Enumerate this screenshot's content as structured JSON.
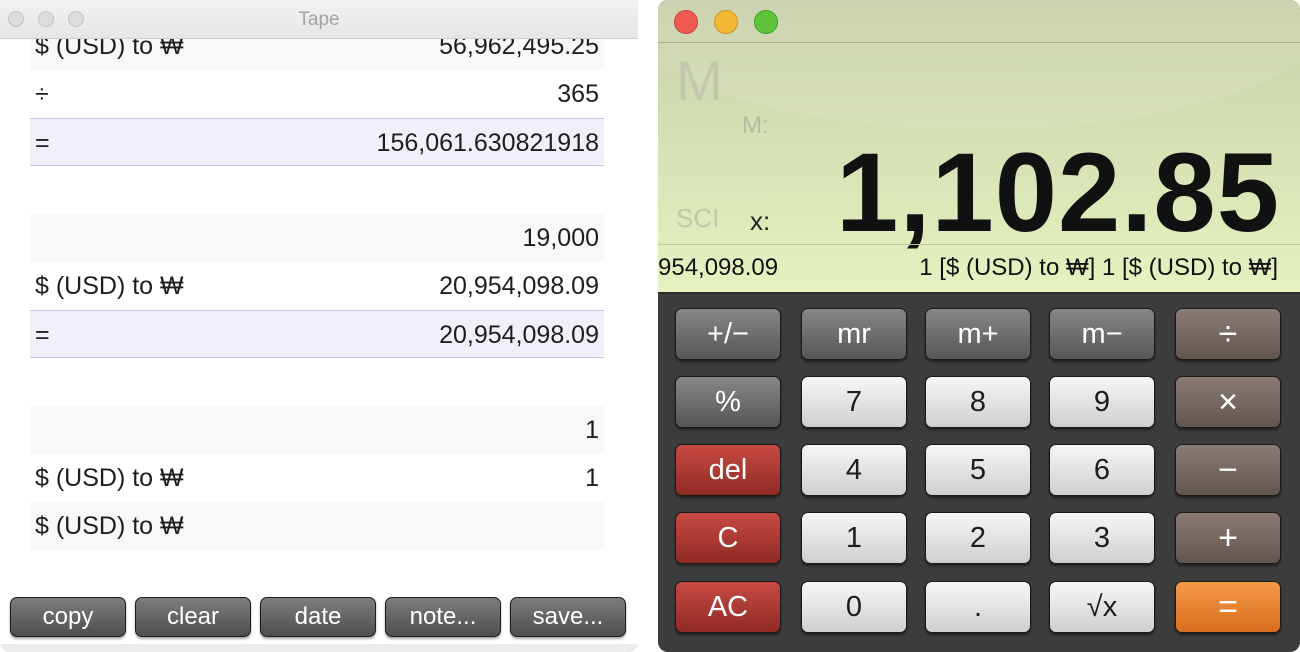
{
  "tape": {
    "title": "Tape",
    "rows": [
      {
        "op": "$ (USD) to ₩",
        "value": "56,962,495.25"
      },
      {
        "op": "÷",
        "value": "365"
      },
      {
        "op": "=",
        "value": "156,061.630821918"
      },
      {
        "op": "",
        "value": ""
      },
      {
        "op": "",
        "value": "19,000"
      },
      {
        "op": "$ (USD) to ₩",
        "value": "20,954,098.09"
      },
      {
        "op": "=",
        "value": "20,954,098.09"
      },
      {
        "op": "",
        "value": ""
      },
      {
        "op": "",
        "value": "1"
      },
      {
        "op": "$ (USD) to ₩",
        "value": "1"
      },
      {
        "op": "$ (USD) to ₩",
        "value": ""
      }
    ],
    "buttons": {
      "copy": "copy",
      "clear": "clear",
      "date": "date",
      "note": "note...",
      "save": "save..."
    }
  },
  "calculator": {
    "display": {
      "memory_indicator": "M",
      "memory_label": "M:",
      "mode_label": "SCI",
      "x_label": "x:",
      "value": "1,102.85",
      "history_left": "954,098.09",
      "history_right": "1 [$ (USD) to ₩]  1 [$ (USD) to ₩]"
    },
    "keys": {
      "plus_minus": "+/−",
      "mr": "mr",
      "m_plus": "m+",
      "m_minus": "m−",
      "divide": "÷",
      "percent": "%",
      "seven": "7",
      "eight": "8",
      "nine": "9",
      "multiply": "×",
      "del": "del",
      "four": "4",
      "five": "5",
      "six": "6",
      "minus": "−",
      "clear": "C",
      "one": "1",
      "two": "2",
      "three": "3",
      "plus": "+",
      "all_clear": "AC",
      "zero": "0",
      "decimal": ".",
      "sqrt": "√x",
      "equals": "="
    }
  },
  "colors": {
    "display_green": "#dbe8b8",
    "key_red": "#b03a34",
    "key_orange": "#e8812f",
    "key_brown": "#6f625b",
    "tape_result_row": "#f0f0fb"
  }
}
